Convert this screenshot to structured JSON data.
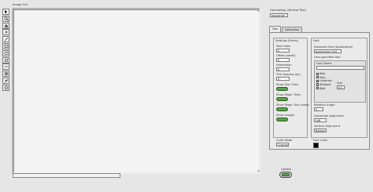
{
  "image_label": "Image Out",
  "toolbar": {
    "tools": [
      {
        "icon": "select-arrow-icon"
      },
      {
        "icon": "zoom-icon"
      },
      {
        "icon": "pan-hand-icon"
      },
      {
        "icon": "point-icon"
      },
      {
        "icon": "line-icon"
      },
      {
        "icon": "rectangle-icon"
      },
      {
        "icon": "oval-icon"
      },
      {
        "icon": "polygon-icon"
      },
      {
        "icon": "freehand-icon"
      },
      {
        "icon": "annulus-icon"
      },
      {
        "icon": "broken-line-icon"
      },
      {
        "icon": "rotated-rect-icon"
      }
    ]
  },
  "orientation": {
    "label": "Orientation (Vertical Text)",
    "value": "horizontal"
  },
  "tabs": [
    {
      "label": "Text",
      "active": true
    },
    {
      "label": "Calibration",
      "active": false
    }
  ],
  "settings": {
    "title": "Settings (Pixels)",
    "fields": [
      {
        "label": "Text Index",
        "value": "0"
      },
      {
        "label": "Offset (width)",
        "value": "0"
      },
      {
        "label": "Separation",
        "value": "0"
      },
      {
        "label": "Tick Spacing (px)",
        "value": "0"
      }
    ],
    "toggles": [
      {
        "label": "Show Sub Ticks"
      },
      {
        "label": "Show Major Ticks"
      },
      {
        "label": "Show Major Tick Labels"
      },
      {
        "label": "Show Length"
      }
    ],
    "color_mode_label": "Color Mode",
    "color_mode_value": "Custom"
  },
  "font": {
    "title": "Font",
    "typeface_label": "Standard Font (Application)",
    "typeface_value": "Application Font",
    "attrs_label": "User-specified font",
    "font_name_label": "Font Name",
    "checks": [
      "Bold",
      "Italic",
      "Underline",
      "Strikeout",
      "Bold"
    ],
    "size_label": "Size",
    "size_value": "8.0",
    "rotation_label": "Rotation Angle",
    "rotation_value": "0",
    "halign_label": "Horizontal Alignment",
    "halign_value": "Left",
    "valign_label": "Vertical Alignment",
    "valign_value": "Bottom"
  },
  "font_color_label": "Font Color",
  "update_label": "Update",
  "colors": {
    "toggle_green": "#5ba64a",
    "font_color": "#000000"
  }
}
